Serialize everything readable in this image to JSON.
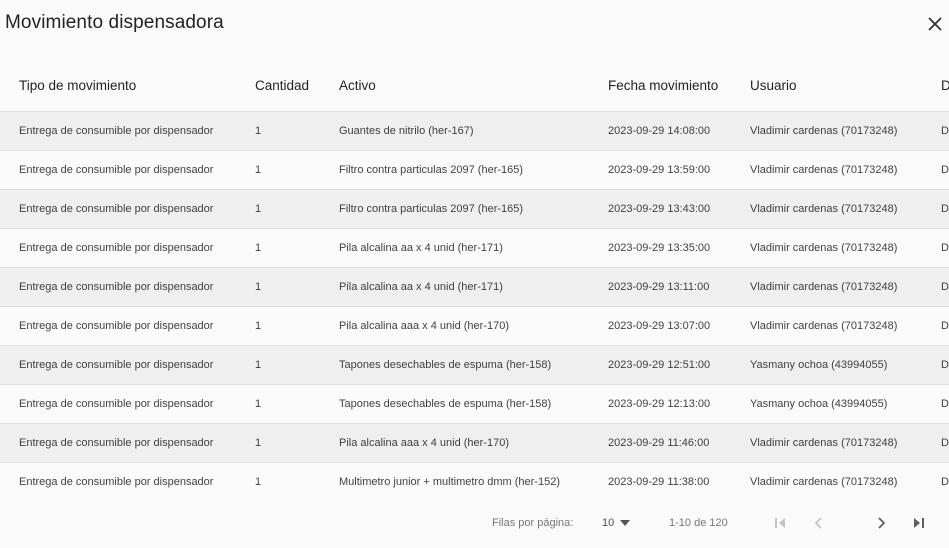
{
  "dialog": {
    "title": "Movimiento dispensadora",
    "close_icon": "close-icon"
  },
  "table": {
    "columns": [
      "Tipo de movimiento",
      "Cantidad",
      "Activo",
      "Fecha movimiento",
      "Usuario",
      "D"
    ],
    "rows": [
      [
        "Entrega de consumible por dispensador",
        "1",
        "Guantes de nitrilo (her-167)",
        "2023-09-29 14:08:00",
        "Vladimir cardenas  (70173248)",
        "Di"
      ],
      [
        "Entrega de consumible por dispensador",
        "1",
        "Filtro contra particulas 2097 (her-165)",
        "2023-09-29 13:59:00",
        "Vladimir cardenas  (70173248)",
        "Di"
      ],
      [
        "Entrega de consumible por dispensador",
        "1",
        "Filtro contra particulas 2097 (her-165)",
        "2023-09-29 13:43:00",
        "Vladimir cardenas  (70173248)",
        "Di"
      ],
      [
        "Entrega de consumible por dispensador",
        "1",
        "Pila alcalina aa x 4 unid (her-171)",
        "2023-09-29 13:35:00",
        "Vladimir cardenas  (70173248)",
        "Di"
      ],
      [
        "Entrega de consumible por dispensador",
        "1",
        "Pila alcalina aa x 4 unid (her-171)",
        "2023-09-29 13:11:00",
        "Vladimir cardenas  (70173248)",
        "Di"
      ],
      [
        "Entrega de consumible por dispensador",
        "1",
        "Pila alcalina aaa x 4 unid (her-170)",
        "2023-09-29 13:07:00",
        "Vladimir cardenas  (70173248)",
        "Di"
      ],
      [
        "Entrega de consumible por dispensador",
        "1",
        "Tapones desechables de espuma (her-158)",
        "2023-09-29 12:51:00",
        "Yasmany ochoa  (43994055)",
        "Di"
      ],
      [
        "Entrega de consumible por dispensador",
        "1",
        "Tapones desechables de espuma (her-158)",
        "2023-09-29 12:13:00",
        "Yasmany ochoa  (43994055)",
        "Di"
      ],
      [
        "Entrega de consumible por dispensador",
        "1",
        "Pila alcalina aaa x 4 unid (her-170)",
        "2023-09-29 11:46:00",
        "Vladimir cardenas  (70173248)",
        "Di"
      ],
      [
        "Entrega de consumible por dispensador",
        "1",
        "Multimetro junior + multimetro dmm (her-152)",
        "2023-09-29 11:38:00",
        "Vladimir cardenas  (70173248)",
        "Di"
      ]
    ]
  },
  "pagination": {
    "rows_per_page_label": "Filas por página:",
    "rows_per_page_value": "10",
    "range_label": "1-10 de 120",
    "icons": [
      "first-page-icon",
      "previous-page-icon",
      "next-page-icon",
      "last-page-icon"
    ],
    "disabled_color": "#c4c4c4",
    "enabled_color": "#5f5f5f"
  }
}
